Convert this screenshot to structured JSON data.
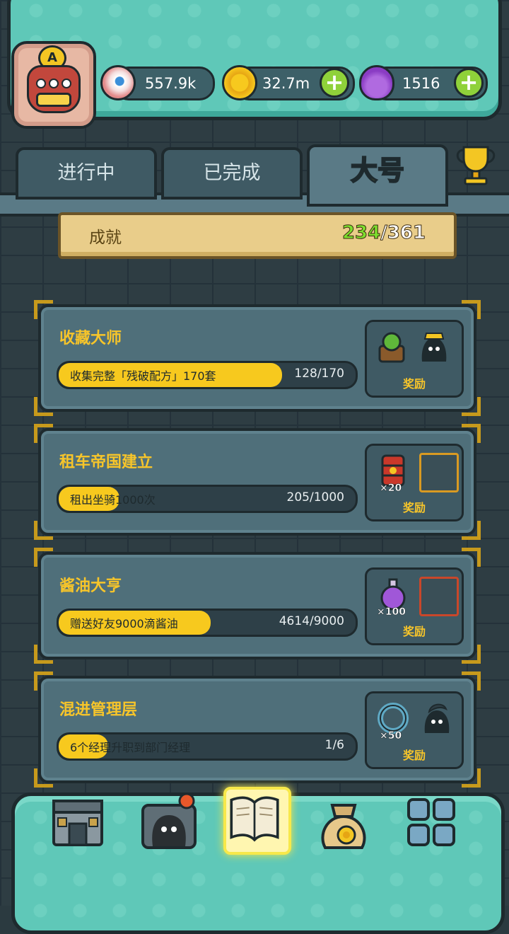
{
  "resources": {
    "eyes": "557.9k",
    "coins": "32.7m",
    "potions": "1516",
    "plus": "+"
  },
  "avatar": {
    "rank": "A"
  },
  "tabs": [
    {
      "label": "进行中"
    },
    {
      "label": "已完成"
    },
    {
      "label": "大号"
    }
  ],
  "summary": {
    "label": "成就",
    "completed": "234",
    "total": "/361"
  },
  "achievements": [
    {
      "title": "收藏大师",
      "desc": "收集完整「残破配方」170套",
      "progress": "128/170",
      "progress_fraction": 0.753,
      "reward_label": "奖励",
      "reward_qty": ""
    },
    {
      "title": "租车帝国建立",
      "desc": "租出坐骑1000次",
      "progress": "205/1000",
      "progress_fraction": 0.205,
      "reward_label": "奖励",
      "reward_qty": "×20"
    },
    {
      "title": "酱油大亨",
      "desc": "赠送好友9000滴酱油",
      "progress": "4614/9000",
      "progress_fraction": 0.513,
      "reward_label": "奖励",
      "reward_qty": "×100"
    },
    {
      "title": "混进管理层",
      "desc": "6个经理升职到部门经理",
      "progress": "1/6",
      "progress_fraction": 0.167,
      "reward_label": "奖励",
      "reward_qty": "×50"
    }
  ],
  "colors": {
    "accent": "#f7c52a",
    "teal": "#5fc8b8",
    "progress": "#f7c91e",
    "green": "#8fd13a"
  },
  "bottom_nav": [
    "shop-icon",
    "monster-icon",
    "achievement-book-icon",
    "coin-bag-icon",
    "grid-menu-icon"
  ]
}
